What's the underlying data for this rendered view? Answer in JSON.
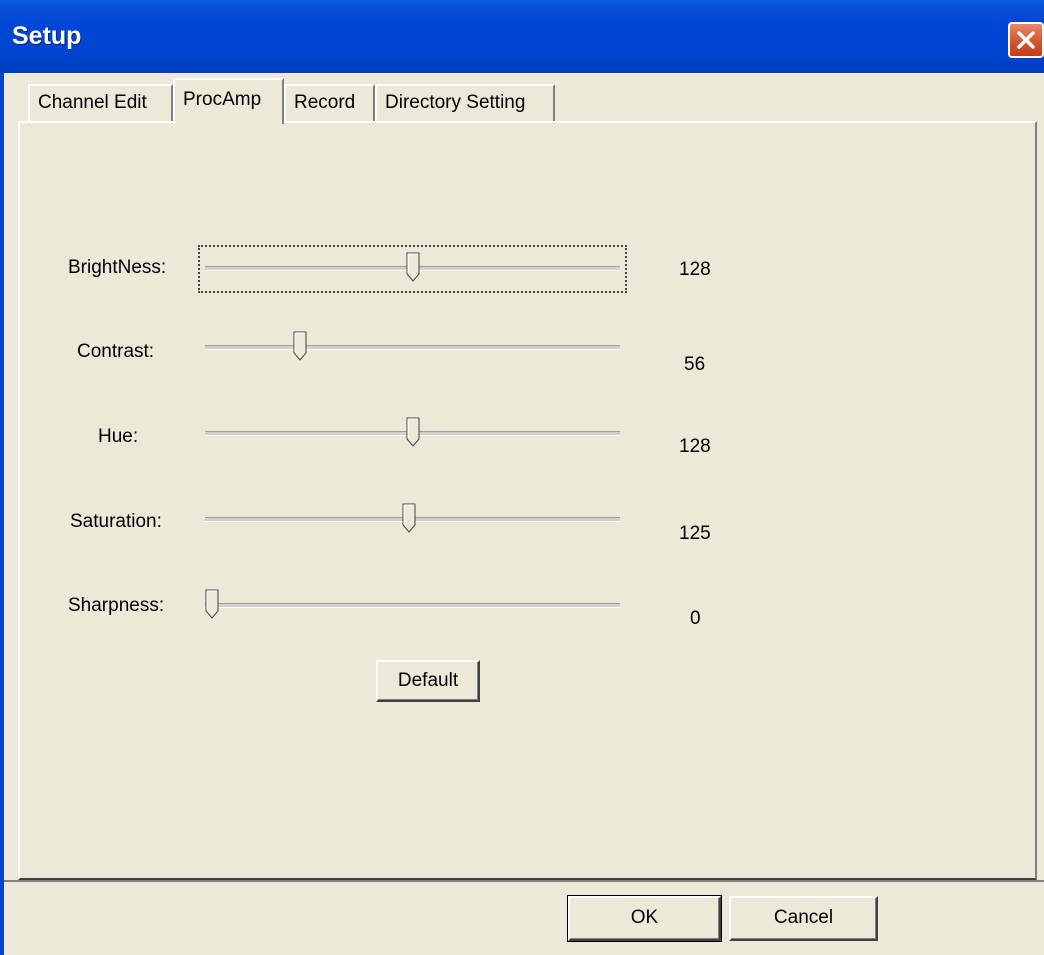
{
  "window": {
    "title": "Setup"
  },
  "tabs": [
    {
      "label": "Channel Edit",
      "active": false
    },
    {
      "label": "ProcAmp",
      "active": true
    },
    {
      "label": "Record",
      "active": false
    },
    {
      "label": "Directory Setting",
      "active": false
    }
  ],
  "procamp": {
    "range": [
      0,
      255
    ],
    "sliders": [
      {
        "label": "BrightNess:",
        "value": "128",
        "level": 128,
        "focused": true
      },
      {
        "label": "Contrast:",
        "value": "56",
        "level": 56
      },
      {
        "label": "Hue:",
        "value": "128",
        "level": 128
      },
      {
        "label": "Saturation:",
        "value": "125",
        "level": 125
      },
      {
        "label": "Sharpness:",
        "value": "0",
        "level": 0
      }
    ],
    "default_label": "Default"
  },
  "buttons": {
    "ok": "OK",
    "cancel": "Cancel"
  },
  "colors": {
    "face": "#ece9d8",
    "titlebar": "#0045d0",
    "close": "#d45a34"
  }
}
